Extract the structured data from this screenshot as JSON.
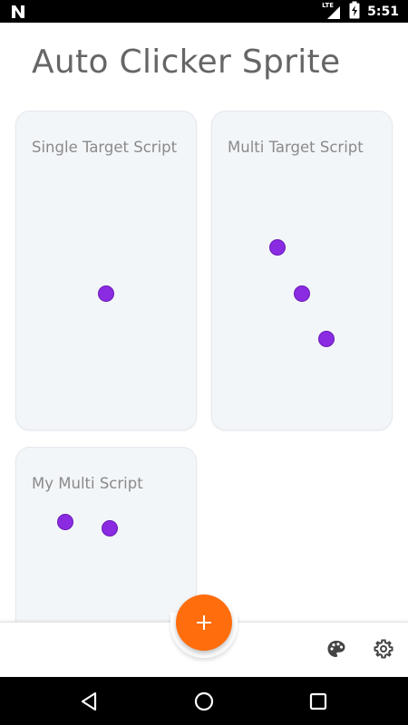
{
  "status_bar": {
    "time": "5:51",
    "network_label": "LTE",
    "left_icon": "notification-n-icon",
    "icons": [
      "signal-icon",
      "battery-icon"
    ]
  },
  "app": {
    "title": "Auto Clicker Sprite"
  },
  "scripts": [
    {
      "name": "Single Target Script",
      "target_count": 1
    },
    {
      "name": "Multi Target Script",
      "target_count": 3
    },
    {
      "name": "My Multi Script",
      "target_count": 2
    }
  ],
  "bottom_bar": {
    "add_label": "+",
    "icons": [
      "palette-icon",
      "settings-icon"
    ]
  },
  "nav_bar": {
    "icons": [
      "back-icon",
      "home-icon",
      "recents-icon"
    ]
  },
  "colors": {
    "accent": "#ff6d0d",
    "target_dot": "#8a2be2",
    "card_background": "#f3f6f9",
    "title_text": "#666666"
  }
}
